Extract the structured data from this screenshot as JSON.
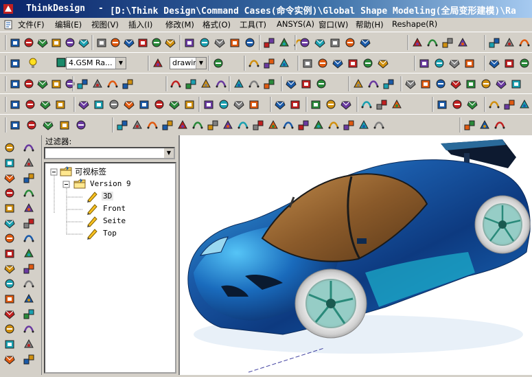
{
  "window": {
    "app_name": "ThinkDesign",
    "separator": "-",
    "path": "[D:\\Think Design\\Command Cases(命令实例)\\Global Shape Modeling(全局变形建模)\\Ra"
  },
  "menu": {
    "items": [
      {
        "label": "文件(F)"
      },
      {
        "label": "编辑(E)"
      },
      {
        "label": "视图(V)"
      },
      {
        "label": "插入(I)"
      },
      {
        "label": "修改(M)"
      },
      {
        "label": "格式(O)"
      },
      {
        "label": "工具(T)"
      },
      {
        "label": "ANSYS(A)"
      },
      {
        "label": "窗口(W)"
      },
      {
        "label": "帮助(H)"
      },
      {
        "label": "Reshape(R)"
      }
    ]
  },
  "toolbar": {
    "layer_combo": "4.GSM Ra...",
    "drawing_combo": "drawir"
  },
  "panel": {
    "filter_label": "过滤器:",
    "filter_value": ""
  },
  "tree": {
    "root": "可视标签",
    "version": "Version 9",
    "views": [
      "3D",
      "Front",
      "Seite",
      "Top"
    ]
  },
  "colors": {
    "title_start": "#0a246a",
    "title_end": "#a6caf0",
    "car_body": "#1a5aa8",
    "car_body_light": "#39b3e8",
    "glass": "#8a5a2a",
    "wheel_rim": "#3aa89a"
  }
}
